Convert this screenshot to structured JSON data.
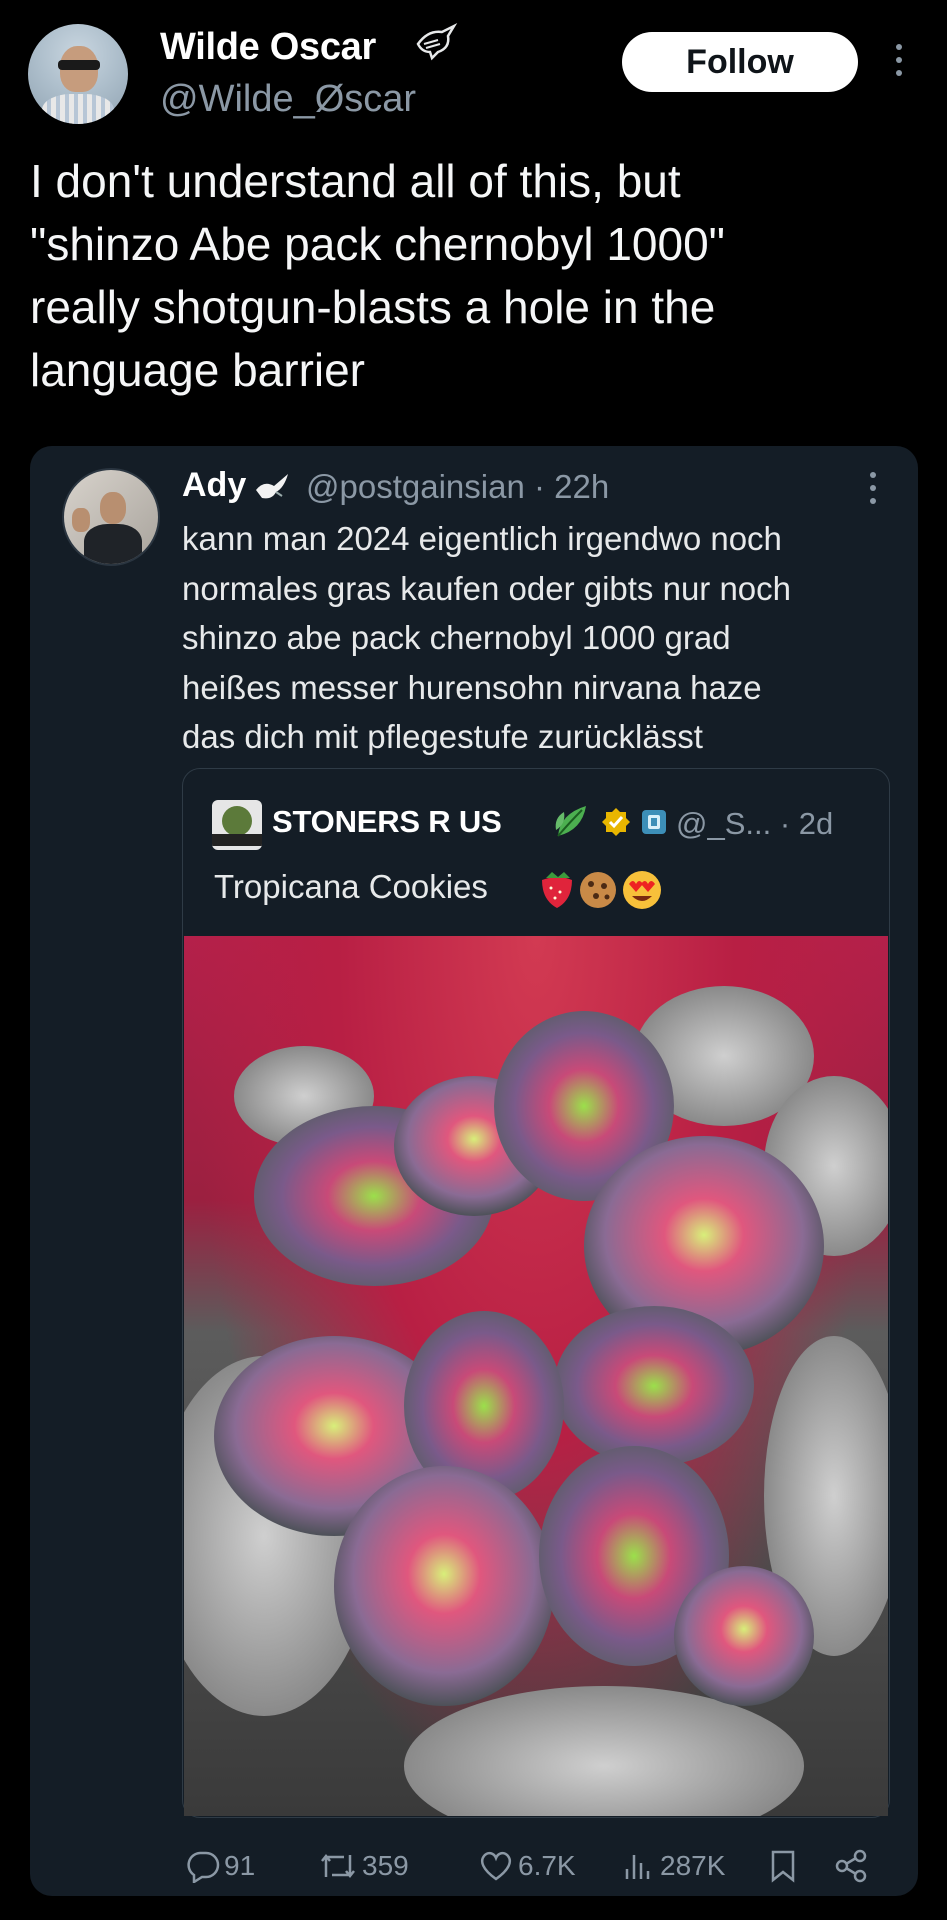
{
  "author": {
    "display_name": "Wilde Oscar",
    "handle": "@Wilde_Øscar",
    "follow_label": "Follow"
  },
  "tweet": {
    "text": "I don't understand all of this,  but\n\"shinzo Abe pack chernobyl 1000\"\nreally shotgun-blasts a hole in the\nlanguage barrier"
  },
  "quoted": {
    "display_name": "Ady",
    "handle_time": "@postgainsian · 22h",
    "text": "kann man 2024 eigentlich irgendwo noch\nnormales gras kaufen oder gibts nur noch\nshinzo abe pack chernobyl 1000 grad\nheißes messer hurensohn nirvana haze\ndas dich mit pflegestufe zurücklässt",
    "nested": {
      "display_name": "STONERS R US",
      "handle_time": "@_S... · 2d",
      "text": "Tropicana Cookies",
      "image_icon": "cannabis-photo"
    },
    "stats": {
      "replies": "91",
      "reposts": "359",
      "likes": "6.7K",
      "views": "287K"
    }
  },
  "colors": {
    "background": "#000000",
    "card": "#141d26",
    "muted": "#8b98a5",
    "verified_gold": "#e8b600"
  }
}
